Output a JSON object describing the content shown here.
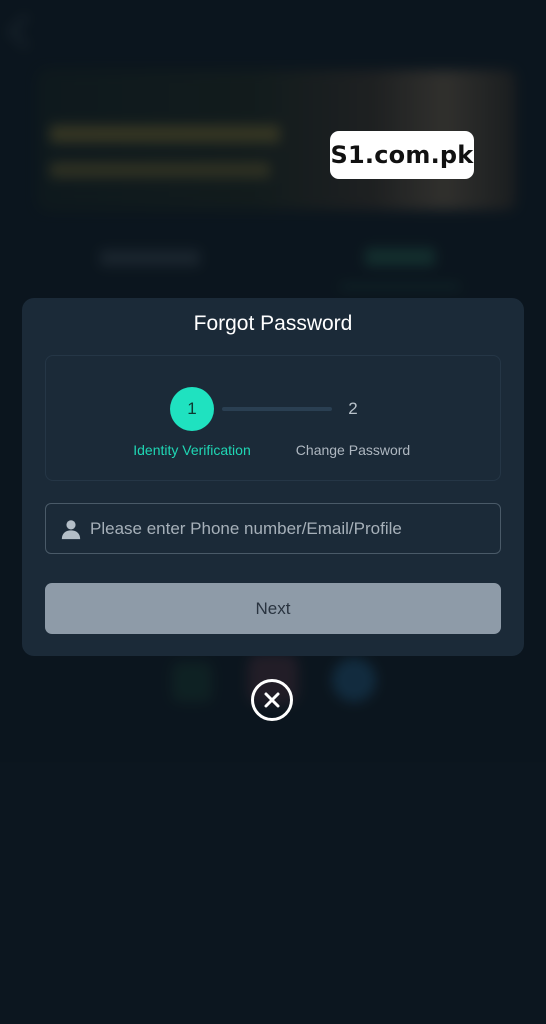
{
  "watermark": {
    "text": "S1.com.pk"
  },
  "modal": {
    "title": "Forgot Password",
    "steps": [
      {
        "number": "1",
        "label": "Identity Verification",
        "active": true
      },
      {
        "number": "2",
        "label": "Change Password",
        "active": false
      }
    ],
    "input": {
      "value": "",
      "placeholder": "Please enter Phone number/Email/Profile",
      "icon": "user-icon"
    },
    "next_button": {
      "label": "Next"
    },
    "close_icon": "close-icon"
  },
  "colors": {
    "accent": "#1fe2c0",
    "modal_bg": "#1b2a38",
    "button_bg": "#8e9ba8",
    "page_bg": "#0f1a24"
  }
}
